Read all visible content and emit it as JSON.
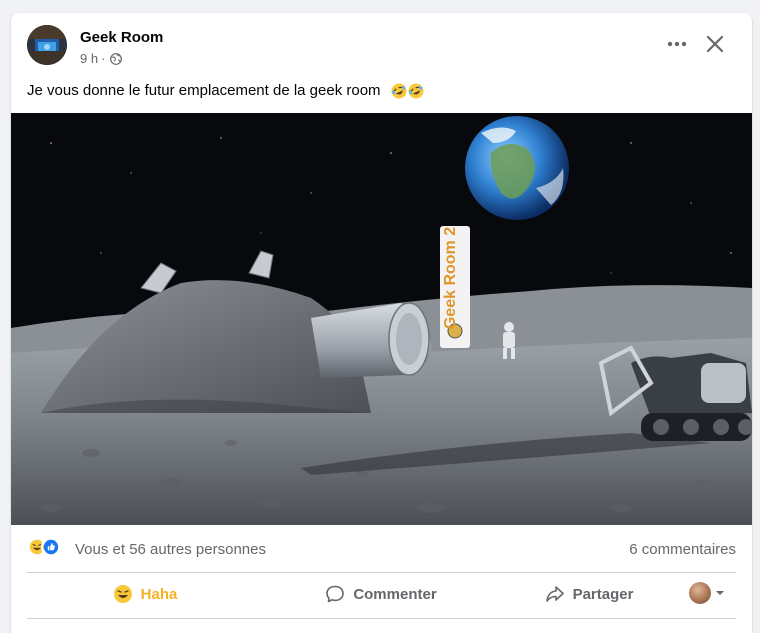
{
  "post": {
    "author": "Geek Room",
    "time": "9 h",
    "separator": "·",
    "privacy_icon": "globe-icon",
    "text": "Je vous donne le futur emplacement de la geek room",
    "text_emoji": "rolling-on-floor-laughing-icon",
    "image_sign_text": "Geek Room 2"
  },
  "stats": {
    "reaction_icons": [
      "haha-icon",
      "like-icon"
    ],
    "reactions_label": "Vous et 56 autres personnes",
    "comments_label": "6 commentaires"
  },
  "actions": {
    "haha_label": "Haha",
    "comment_label": "Commenter",
    "share_label": "Partager"
  },
  "colors": {
    "haha": "#f7b125",
    "like_blue": "#1877f2",
    "secondary_text": "#65676b",
    "background": "#f0f2f5"
  }
}
